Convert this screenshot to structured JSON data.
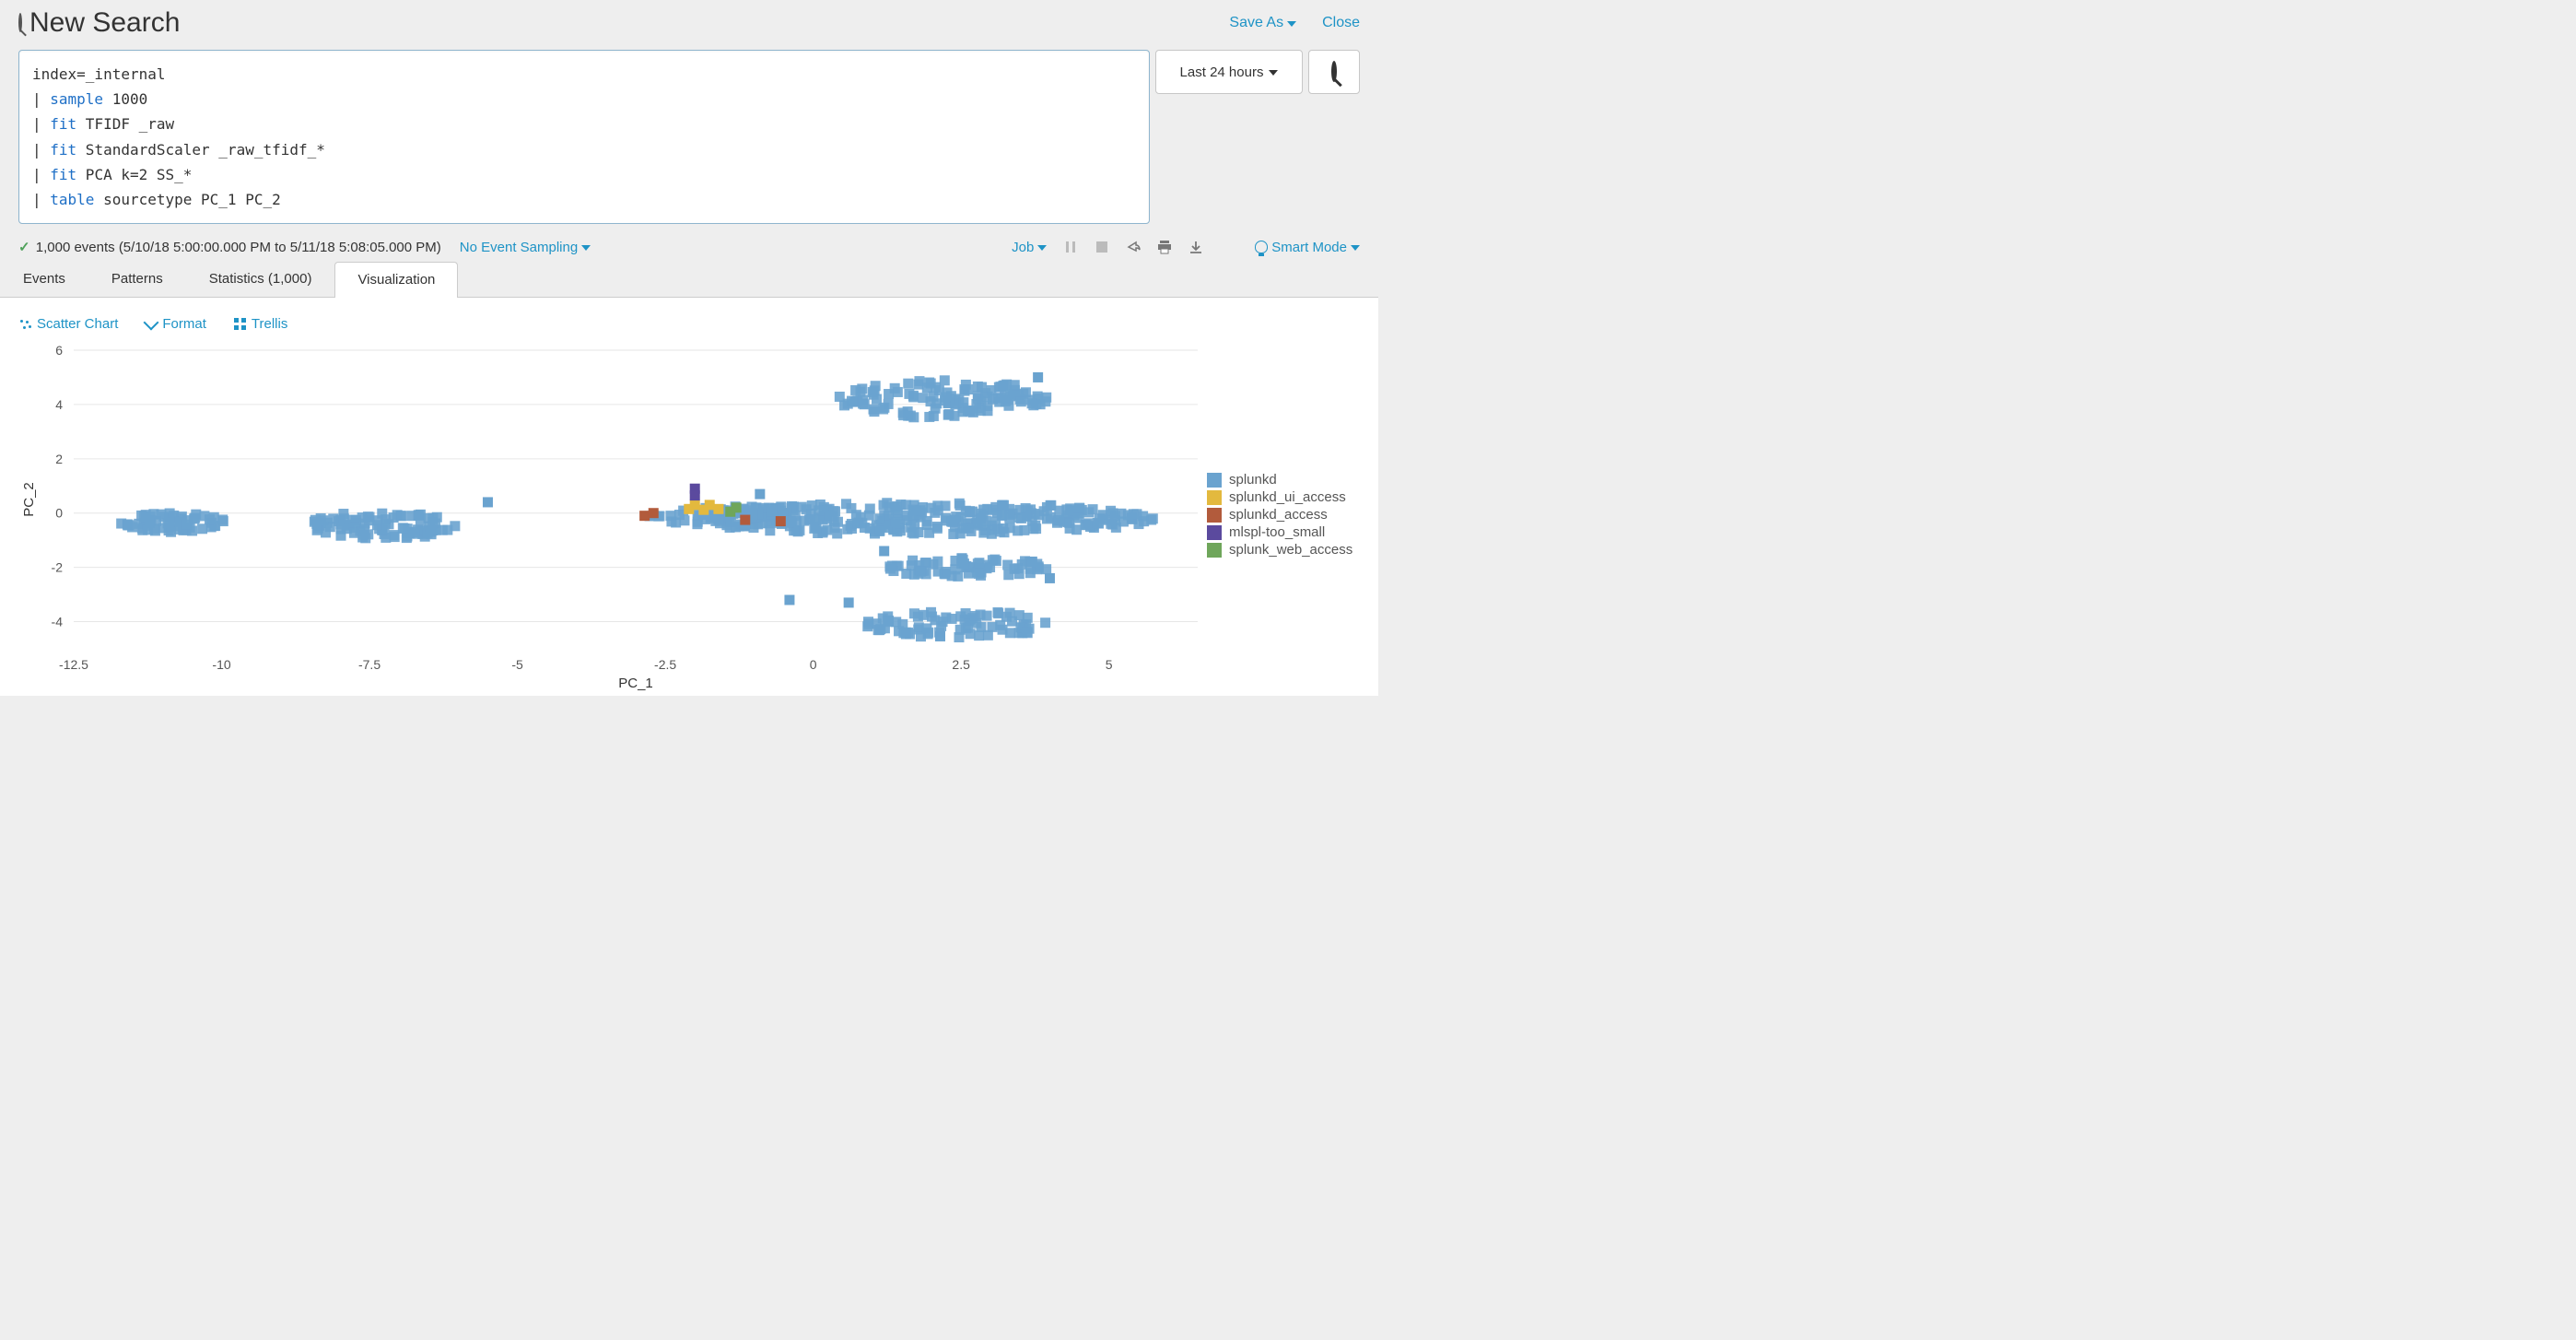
{
  "header": {
    "title": "New Search",
    "save_as": "Save As",
    "close": "Close"
  },
  "search": {
    "query_lines": [
      {
        "pre": "",
        "cmd": "",
        "rest": "index=_internal"
      },
      {
        "pre": "| ",
        "cmd": "sample",
        "rest": " 1000"
      },
      {
        "pre": "| ",
        "cmd": "fit",
        "rest": " TFIDF _raw"
      },
      {
        "pre": "| ",
        "cmd": "fit",
        "rest": " StandardScaler _raw_tfidf_*"
      },
      {
        "pre": "| ",
        "cmd": "fit",
        "rest": " PCA k=2 SS_*"
      },
      {
        "pre": "| ",
        "cmd": "table",
        "rest": " sourcetype PC_1 PC_2"
      }
    ],
    "time_range": "Last 24 hours"
  },
  "infobar": {
    "events_text": "1,000 events (5/10/18 5:00:00.000 PM to 5/11/18 5:08:05.000 PM)",
    "sampling": "No Event Sampling",
    "job": "Job",
    "mode": "Smart Mode"
  },
  "tabs": {
    "events": "Events",
    "patterns": "Patterns",
    "statistics": "Statistics (1,000)",
    "visualization": "Visualization"
  },
  "viz_toolbar": {
    "chart_type": "Scatter Chart",
    "format": "Format",
    "trellis": "Trellis"
  },
  "legend": {
    "items": [
      {
        "label": "splunkd",
        "color": "#6aa3cf"
      },
      {
        "label": "splunkd_ui_access",
        "color": "#e3b93e"
      },
      {
        "label": "splunkd_access",
        "color": "#b25b3c"
      },
      {
        "label": "mlspl-too_small",
        "color": "#5b4a9e"
      },
      {
        "label": "splunk_web_access",
        "color": "#6fa65b"
      }
    ]
  },
  "chart_data": {
    "type": "scatter",
    "title": "",
    "xlabel": "PC_1",
    "ylabel": "PC_2",
    "xlim": [
      -12.5,
      6.5
    ],
    "ylim": [
      -5,
      6
    ],
    "x_ticks": [
      -12.5,
      -10,
      -7.5,
      -5,
      -2.5,
      0,
      2.5,
      5
    ],
    "y_ticks": [
      -4,
      -2,
      0,
      2,
      4,
      6
    ],
    "series": [
      {
        "name": "splunkd",
        "color": "#6aa3cf",
        "clusters": [
          {
            "cx": -10.8,
            "cy": -0.35,
            "rx": 0.9,
            "ry": 0.35,
            "n": 60
          },
          {
            "cx": -7.3,
            "cy": -0.45,
            "rx": 1.4,
            "ry": 0.5,
            "n": 90
          },
          {
            "cx": 2.2,
            "cy": 4.2,
            "rx": 1.8,
            "ry": 0.7,
            "n": 120
          },
          {
            "cx": 1.8,
            "cy": -0.2,
            "rx": 4.0,
            "ry": 0.6,
            "n": 300
          },
          {
            "cx": 2.6,
            "cy": -2.0,
            "rx": 1.4,
            "ry": 0.35,
            "n": 70
          },
          {
            "cx": 2.5,
            "cy": -4.1,
            "rx": 1.6,
            "ry": 0.5,
            "n": 80
          },
          {
            "cx": -1.2,
            "cy": -0.1,
            "rx": 1.6,
            "ry": 0.35,
            "n": 70
          }
        ],
        "extras": [
          {
            "x": -5.5,
            "y": 0.4
          },
          {
            "x": 3.8,
            "y": 5.0
          },
          {
            "x": -0.9,
            "y": 0.7
          },
          {
            "x": 4.0,
            "y": -2.4
          },
          {
            "x": -0.4,
            "y": -3.2
          },
          {
            "x": 0.6,
            "y": -3.3
          },
          {
            "x": 1.2,
            "y": -1.4
          }
        ]
      },
      {
        "name": "splunkd_ui_access",
        "color": "#e3b93e",
        "points": [
          {
            "x": -2.1,
            "y": 0.15
          },
          {
            "x": -1.85,
            "y": 0.12
          },
          {
            "x": -1.6,
            "y": 0.15
          },
          {
            "x": -2.0,
            "y": 0.3
          },
          {
            "x": -1.75,
            "y": 0.3
          }
        ]
      },
      {
        "name": "splunkd_access",
        "color": "#b25b3c",
        "points": [
          {
            "x": -2.85,
            "y": -0.1
          },
          {
            "x": -2.7,
            "y": 0.0
          },
          {
            "x": -1.15,
            "y": -0.25
          },
          {
            "x": -0.55,
            "y": -0.3
          }
        ]
      },
      {
        "name": "mlspl-too_small",
        "color": "#5b4a9e",
        "points": [
          {
            "x": -2.0,
            "y": 0.9
          },
          {
            "x": -2.0,
            "y": 0.65
          }
        ]
      },
      {
        "name": "splunk_web_access",
        "color": "#6fa65b",
        "points": [
          {
            "x": -1.4,
            "y": 0.05
          },
          {
            "x": -1.3,
            "y": 0.2
          }
        ]
      }
    ]
  }
}
